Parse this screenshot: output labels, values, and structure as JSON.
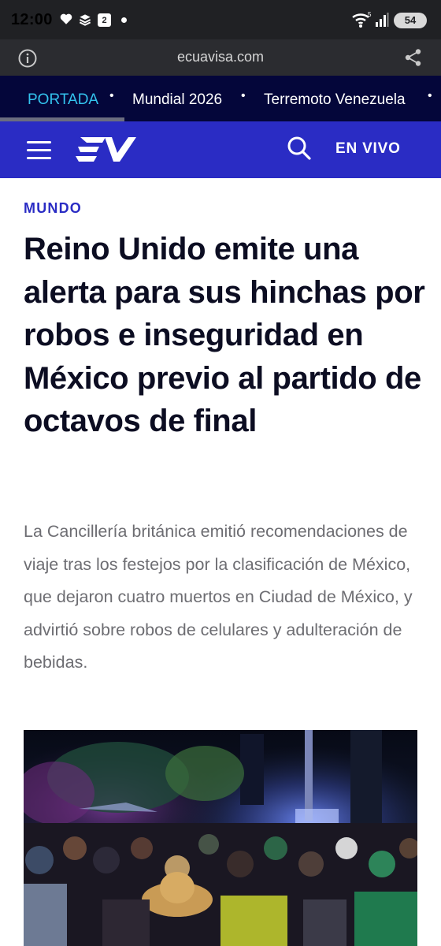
{
  "status_bar": {
    "time": "12:00",
    "calendar_badge": "2",
    "battery": "54",
    "wifi_badge": "5",
    "icons": [
      "heart-icon",
      "stack-icon",
      "calendar-icon",
      "dot-icon",
      "wifi-icon",
      "signal-icon",
      "battery-icon"
    ]
  },
  "browser": {
    "url": "ecuavisa.com",
    "icons": [
      "info-icon",
      "share-icon"
    ]
  },
  "trending": {
    "items": [
      {
        "label": "PORTADA",
        "active": true
      },
      {
        "label": "Mundial 2026",
        "active": false
      },
      {
        "label": "Terremoto Venezuela",
        "active": false
      }
    ],
    "separator": "•"
  },
  "header": {
    "logo": "EV",
    "live_label": "EN VIVO",
    "brand_color": "#2a2cc4",
    "icons": [
      "menu-icon",
      "logo",
      "search-icon"
    ]
  },
  "article": {
    "section": "MUNDO",
    "headline": "Reino Unido emite una alerta para sus hinchas por robos e inseguridad en México previo al partido de octavos de final",
    "lead": "La Cancillería británica emitió recomendaciones de viaje tras los festejos por la clasificación de México, que dejaron cuatro muertos en Ciudad de México, y advirtió sobre robos de celulares y adulteración de bebidas."
  }
}
